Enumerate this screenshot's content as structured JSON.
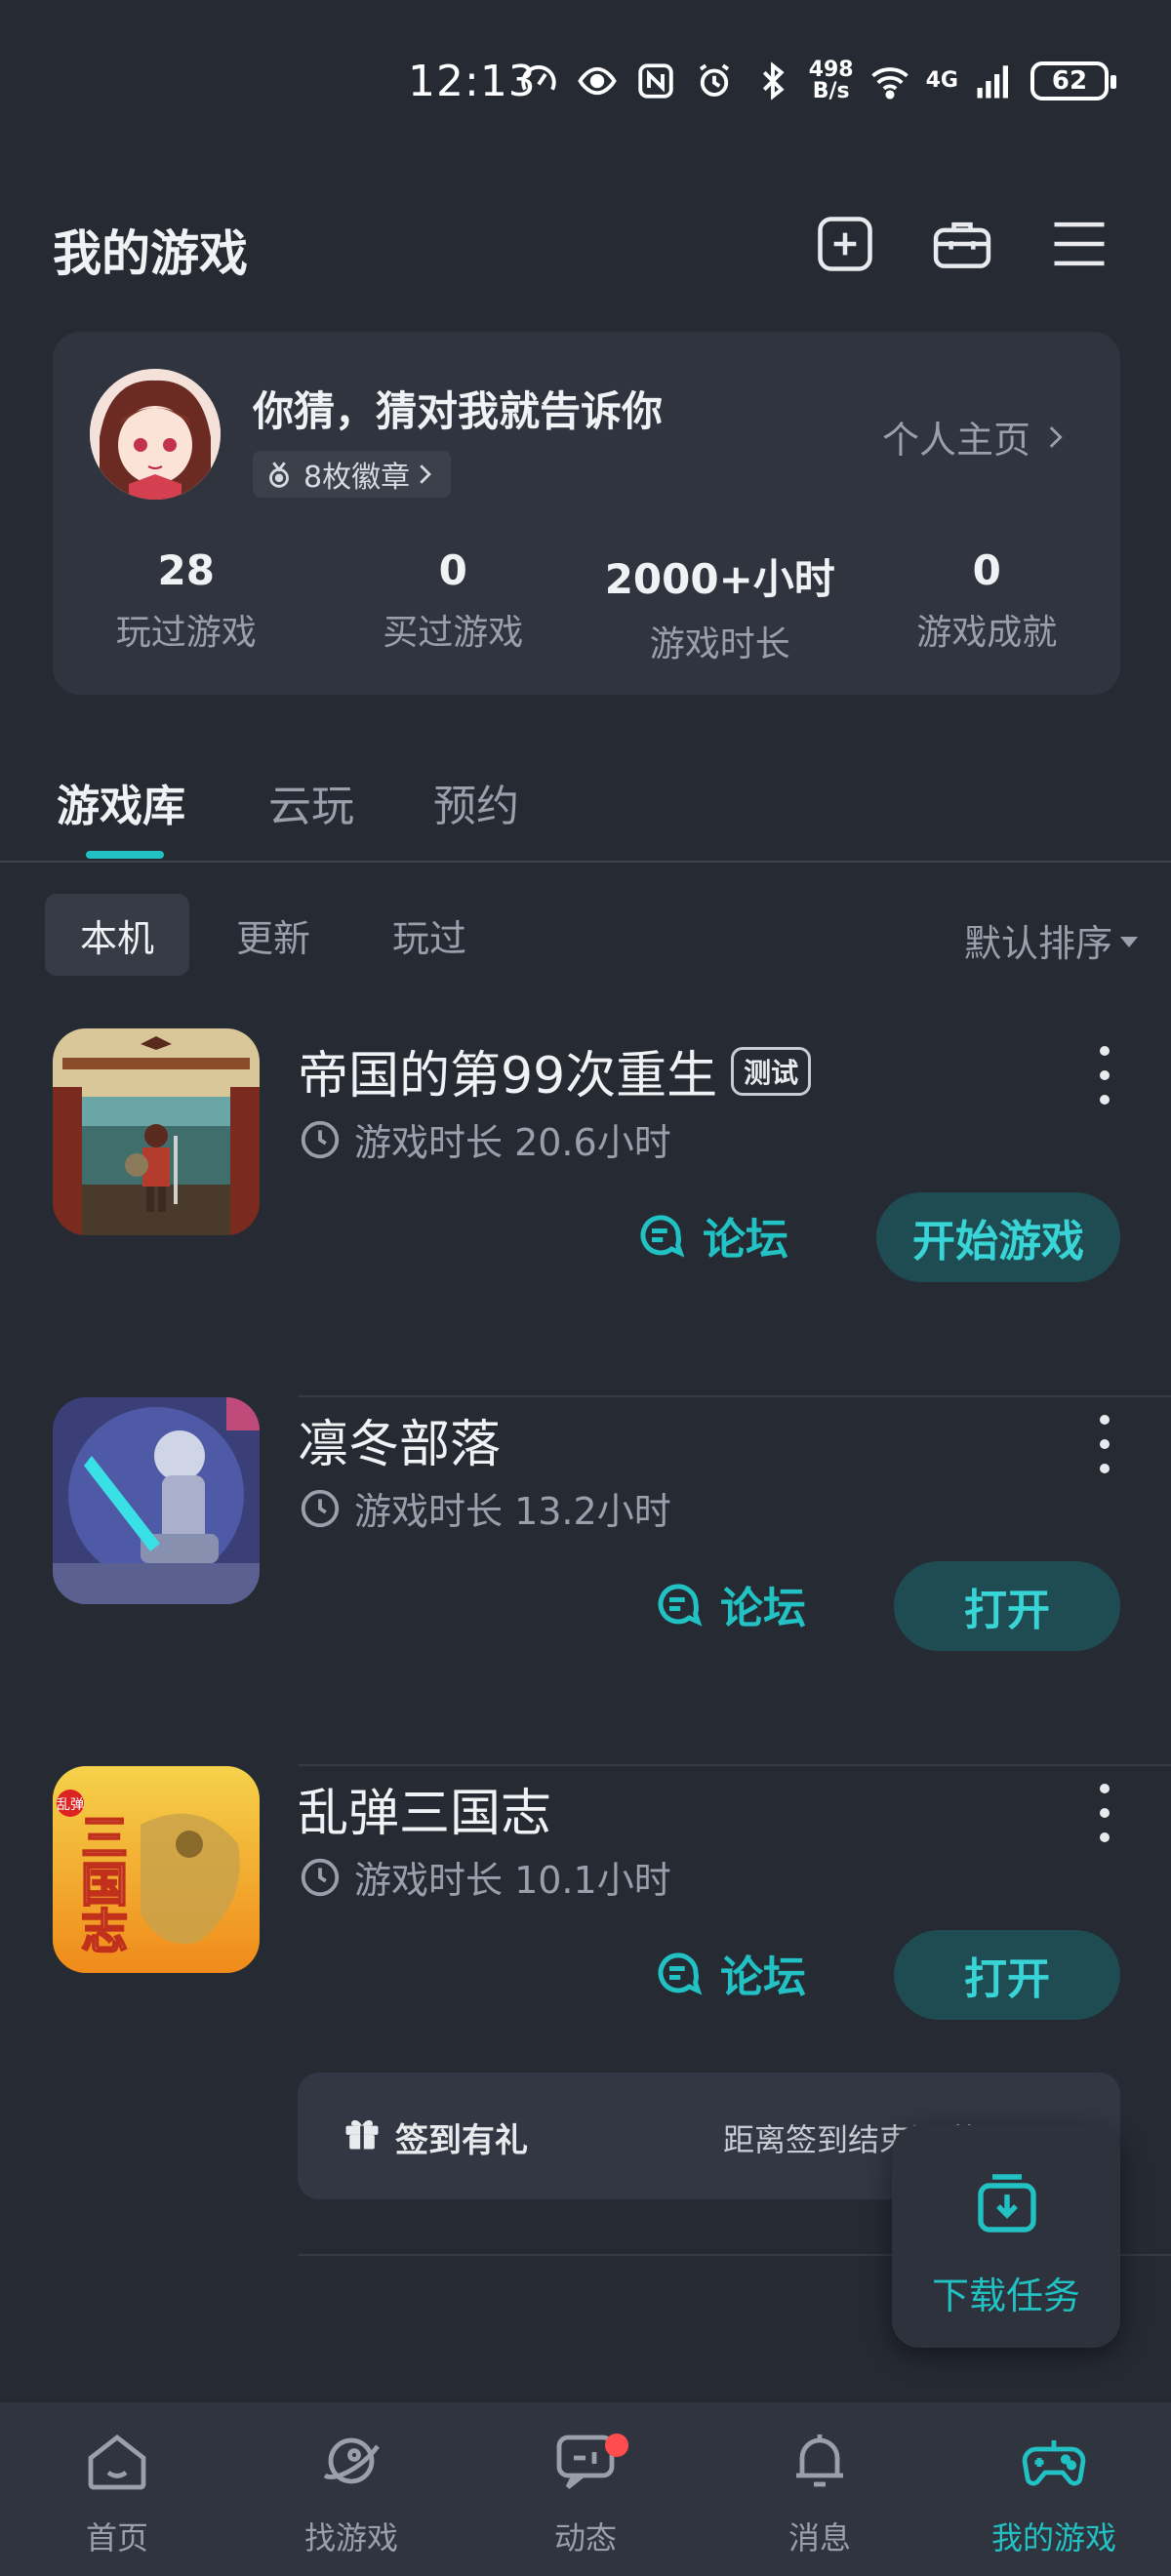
{
  "status_bar": {
    "time": "12:13",
    "net_speed_value": "498",
    "net_speed_unit": "B/s",
    "net_type": "4G",
    "battery": "62"
  },
  "header": {
    "title": "我的游戏",
    "icons": [
      "add-square-icon",
      "toolbox-icon",
      "menu-icon"
    ]
  },
  "profile": {
    "nickname": "你猜，猜对我就告诉你",
    "badges_label": "8枚徽章",
    "homepage_label": "个人主页",
    "stats": [
      {
        "value": "28",
        "label": "玩过游戏"
      },
      {
        "value": "0",
        "label": "买过游戏"
      },
      {
        "value": "2000+小时",
        "label": "游戏时长"
      },
      {
        "value": "0",
        "label": "游戏成就"
      }
    ]
  },
  "tabs": [
    {
      "label": "游戏库",
      "active": true
    },
    {
      "label": "云玩",
      "active": false
    },
    {
      "label": "预约",
      "active": false
    }
  ],
  "subtabs": [
    {
      "label": "本机",
      "active": true
    },
    {
      "label": "更新",
      "active": false
    },
    {
      "label": "玩过",
      "active": false
    }
  ],
  "sort_label": "默认排序",
  "games": [
    {
      "name": "帝国的第99次重生",
      "tag": "测试",
      "playtime": "游戏时长 20.6小时",
      "forum_label": "论坛",
      "action_label": "开始游戏"
    },
    {
      "name": "凛冬部落",
      "tag": "",
      "playtime": "游戏时长 13.2小时",
      "forum_label": "论坛",
      "action_label": "打开"
    },
    {
      "name": "乱弹三国志",
      "tag": "",
      "playtime": "游戏时长 10.1小时",
      "forum_label": "论坛",
      "action_label": "打开"
    }
  ],
  "game3_icon_text": "三国志",
  "game3_icon_badge": "乱弹",
  "signin": {
    "label": "签到有礼",
    "countdown": "距离签到结束还剩"
  },
  "download": {
    "label": "下载任务"
  },
  "bottom_nav": [
    {
      "label": "首页",
      "icon": "home-icon"
    },
    {
      "label": "找游戏",
      "icon": "planet-icon"
    },
    {
      "label": "动态",
      "icon": "chat-icon"
    },
    {
      "label": "消息",
      "icon": "bell-icon"
    },
    {
      "label": "我的游戏",
      "icon": "gamepad-icon",
      "active": true
    }
  ],
  "colors": {
    "accent": "#22c1c3",
    "background": "#262a33",
    "card": "#30343e"
  }
}
